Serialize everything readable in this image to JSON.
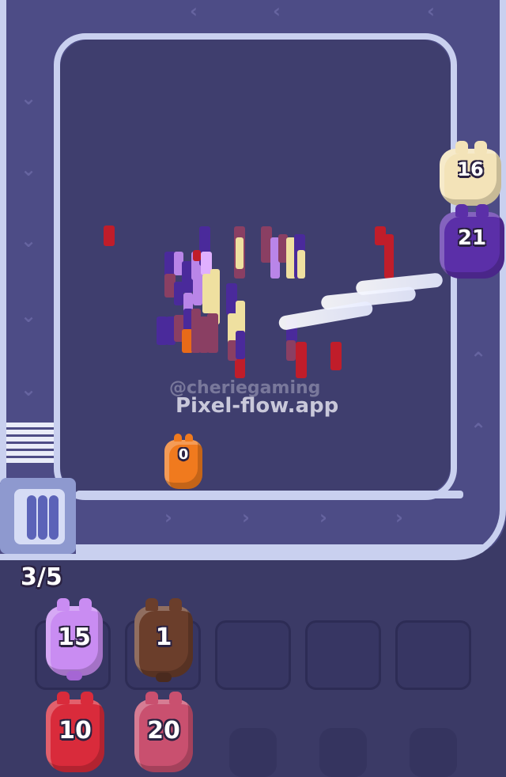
{
  "hud": {
    "queue_counter": "3/5"
  },
  "watermark": {
    "handle": "@cheriegaming",
    "site": "Pixel-flow.app"
  },
  "board": {
    "shooters_on_track": [
      {
        "label": "16",
        "color": "#f3e3b8"
      },
      {
        "label": "21",
        "color": "#5b2fa8"
      },
      {
        "label": "0",
        "color": "#f07a1e"
      }
    ]
  },
  "slots": [
    {
      "label": "15",
      "color": "#c98cf2",
      "state": "filled"
    },
    {
      "label": "1",
      "color": "#6b3e2b",
      "state": "filled"
    },
    {
      "label": "",
      "state": "empty"
    },
    {
      "label": "",
      "state": "empty"
    },
    {
      "label": "",
      "state": "empty"
    }
  ],
  "waiting_row": [
    {
      "label": "10",
      "color": "#d92b3b"
    },
    {
      "label": "20",
      "color": "#c9506f"
    }
  ],
  "colors": {
    "background": "#3b3a66",
    "track": "#4d4c86",
    "rail": "#c9d0ef",
    "block_purple": "#4a2a9b",
    "block_lavender": "#b985e8",
    "block_cream": "#efe0a0",
    "block_red": "#c01d2a",
    "block_mauve": "#8a3f63",
    "block_orange": "#e86a18"
  }
}
